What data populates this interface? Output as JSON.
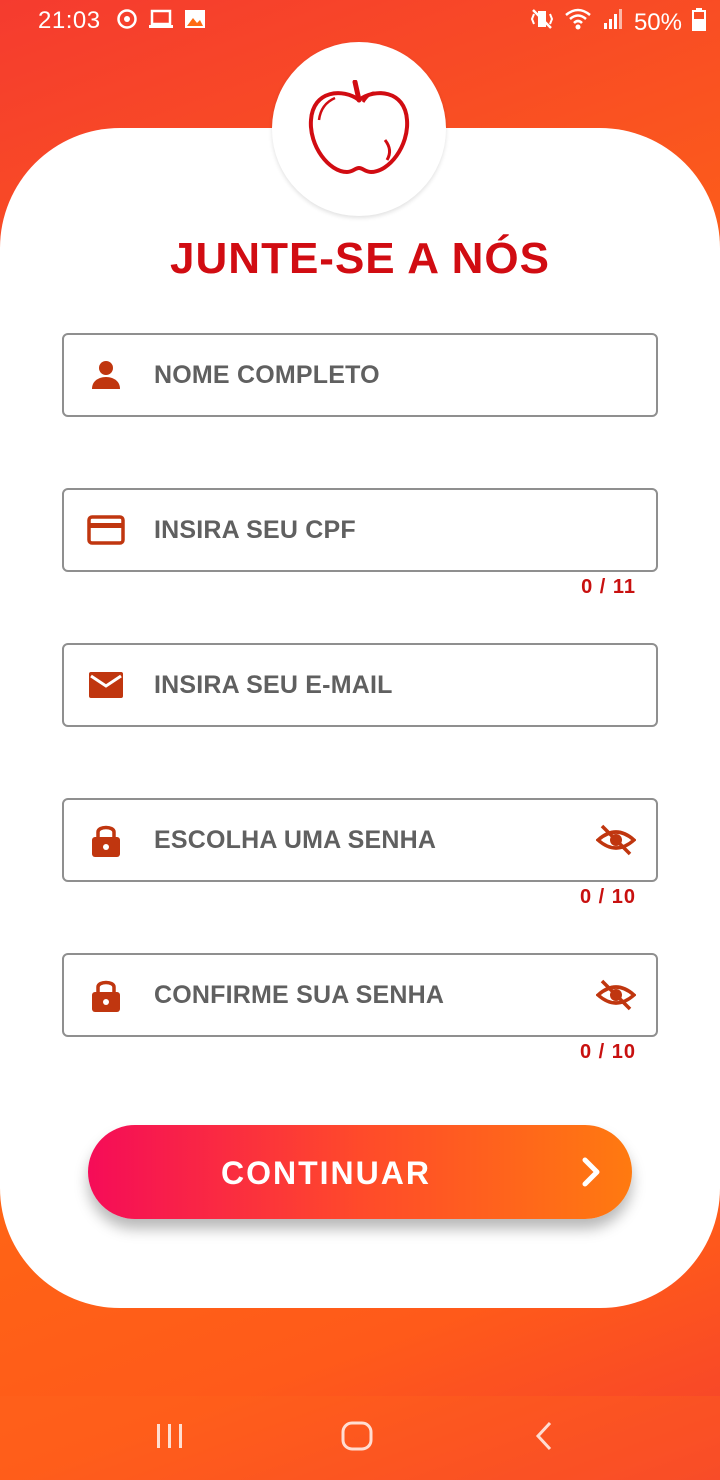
{
  "status_bar": {
    "time": "21:03",
    "battery": "50%",
    "left_icons": [
      "sync-icon",
      "laptop-icon",
      "image-icon"
    ],
    "right_icons": [
      "vibrate-icon",
      "wifi-icon",
      "signal-icon",
      "battery-icon"
    ]
  },
  "form": {
    "title": "JUNTE-SE A NÓS",
    "fields": [
      {
        "label": "NOME COMPLETO",
        "icon": "person-icon"
      },
      {
        "label": "INSIRA SEU CPF",
        "icon": "card-icon",
        "counter": "0 / 11"
      },
      {
        "label": "INSIRA SEU E-MAIL",
        "icon": "mail-icon"
      },
      {
        "label": "ESCOLHA UMA SENHA",
        "icon": "lock-icon",
        "counter": "0 / 10",
        "trailing_icon": "eye-off-icon"
      },
      {
        "label": "CONFIRME SUA SENHA",
        "icon": "lock-icon",
        "counter": "0 / 10",
        "trailing_icon": "eye-off-icon"
      }
    ],
    "submit_label": "CONTINUAR"
  },
  "colors": {
    "accent": "#d10c12",
    "icon": "#c0360f",
    "button_start": "#f50c58",
    "button_end": "#ff7a10"
  },
  "nav_bar": {
    "icons": [
      "recents-icon",
      "home-icon",
      "back-icon"
    ]
  }
}
